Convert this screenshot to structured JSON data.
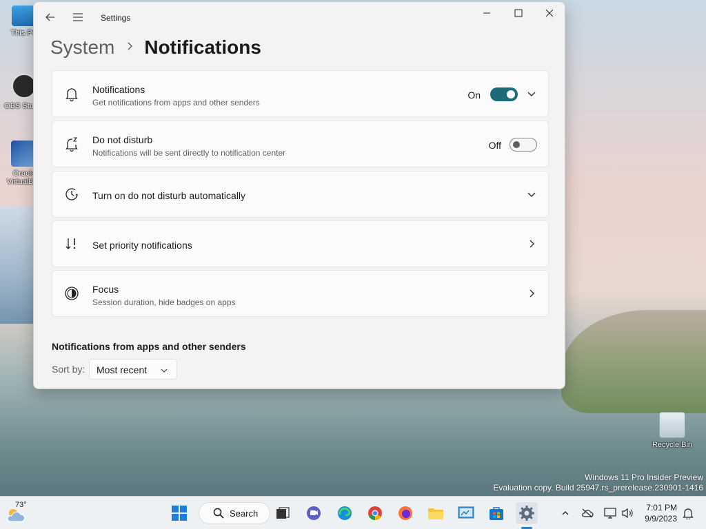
{
  "desktop": {
    "icons": [
      {
        "label": "This PC"
      },
      {
        "label": "OBS Studio"
      },
      {
        "label": "Oracle VirtualBox"
      },
      {
        "label": "Recycle Bin"
      }
    ],
    "watermark": {
      "line1": "Windows 11 Pro Insider Preview",
      "line2": "Evaluation copy. Build 25947.rs_prerelease.230901-1416"
    }
  },
  "window": {
    "app_title": "Settings",
    "breadcrumb": {
      "parent": "System",
      "current": "Notifications"
    },
    "cards": [
      {
        "title": "Notifications",
        "subtitle": "Get notifications from apps and other senders",
        "state_label": "On",
        "state": true,
        "icon": "bell-icon"
      },
      {
        "title": "Do not disturb",
        "subtitle": "Notifications will be sent directly to notification center",
        "state_label": "Off",
        "state": false,
        "icon": "snooze-bell-icon"
      },
      {
        "title": "Turn on do not disturb automatically",
        "icon": "clock-icon"
      },
      {
        "title": "Set priority notifications",
        "icon": "priority-sort-icon"
      },
      {
        "title": "Focus",
        "subtitle": "Session duration, hide badges on apps",
        "icon": "focus-icon"
      }
    ],
    "section_title": "Notifications from apps and other senders",
    "sort": {
      "label": "Sort by:",
      "value": "Most recent"
    }
  },
  "taskbar": {
    "weather": {
      "temp": "73°"
    },
    "search_label": "Search",
    "clock": {
      "time": "7:01 PM",
      "date": "9/9/2023"
    },
    "accent": "#1d6b78"
  }
}
